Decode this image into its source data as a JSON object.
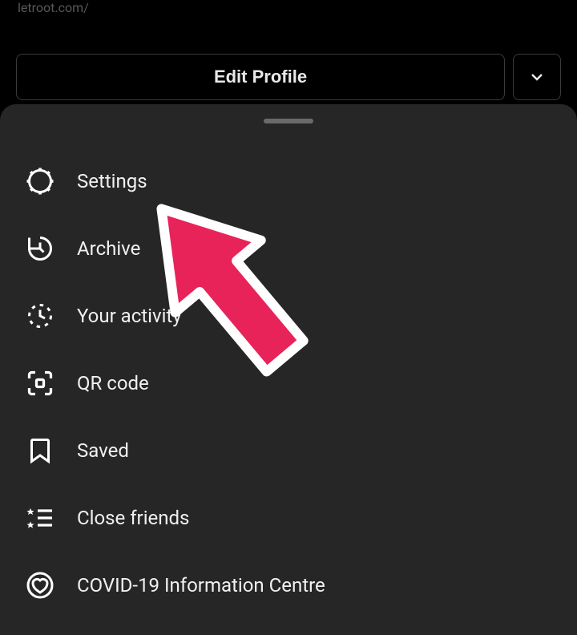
{
  "header": {
    "breadcrumb": "letroot.com/"
  },
  "buttons": {
    "edit_profile": "Edit Profile"
  },
  "menu": {
    "items": [
      {
        "label": "Settings",
        "icon": "settings"
      },
      {
        "label": "Archive",
        "icon": "archive"
      },
      {
        "label": "Your activity",
        "icon": "activity"
      },
      {
        "label": "QR code",
        "icon": "qr"
      },
      {
        "label": "Saved",
        "icon": "saved"
      },
      {
        "label": "Close friends",
        "icon": "closefriends"
      },
      {
        "label": "COVID-19 Information Centre",
        "icon": "covid"
      }
    ]
  },
  "annotation": {
    "color": "#e8235a"
  }
}
